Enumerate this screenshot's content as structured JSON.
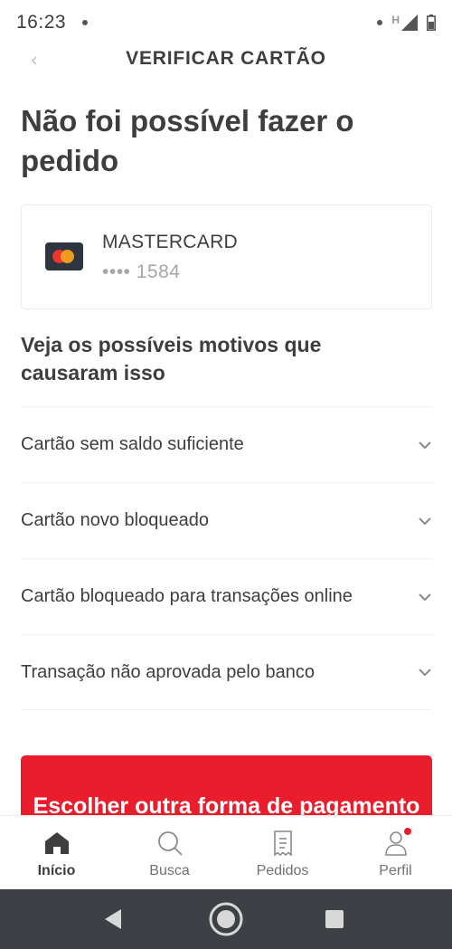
{
  "status_bar": {
    "time": "16:23",
    "network_label": "H"
  },
  "header": {
    "title": "VERIFICAR CARTÃO"
  },
  "page": {
    "title": "Não foi possível fazer o pedido"
  },
  "card": {
    "brand": "MASTERCARD",
    "number": "•••• 1584",
    "logo_colors": {
      "left": "#e8372e",
      "right": "#f5a11b",
      "bg": "#2e3440"
    }
  },
  "reasons": {
    "title": "Veja os possíveis motivos que causaram isso",
    "items": [
      {
        "label": "Cartão sem saldo suficiente"
      },
      {
        "label": "Cartão novo bloqueado"
      },
      {
        "label": "Cartão bloqueado para transações online"
      },
      {
        "label": "Transação não aprovada pelo banco"
      }
    ]
  },
  "cta": {
    "label": "Escolher outra forma de pagamento"
  },
  "bottom_nav": {
    "items": [
      {
        "label": "Início",
        "icon": "home-icon",
        "active": true
      },
      {
        "label": "Busca",
        "icon": "search-icon",
        "active": false
      },
      {
        "label": "Pedidos",
        "icon": "receipt-icon",
        "active": false
      },
      {
        "label": "Perfil",
        "icon": "profile-icon",
        "active": false,
        "notification": true
      }
    ]
  },
  "colors": {
    "accent": "#ea1d2c",
    "text": "#3e3e3e",
    "muted": "#a6a6a6",
    "android_nav_bg": "#3d4044"
  }
}
